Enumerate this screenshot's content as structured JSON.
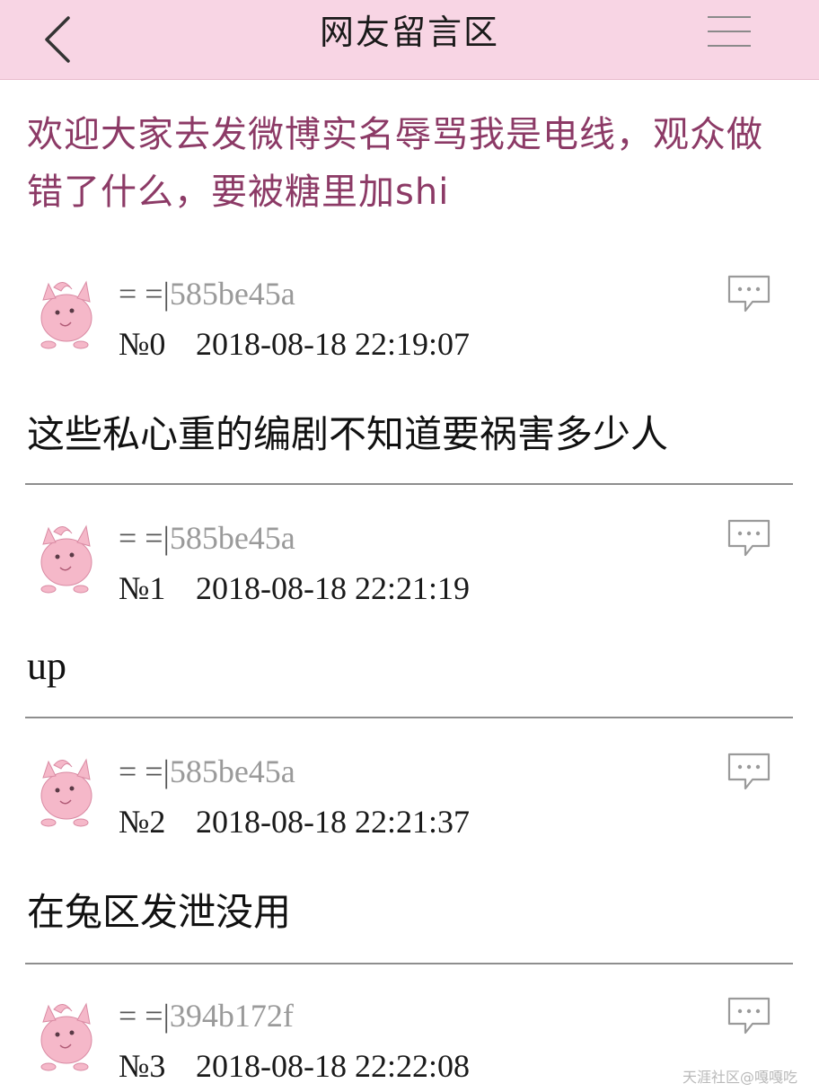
{
  "header": {
    "title": "网友留言区",
    "back_icon": "chevron-left-icon",
    "menu_icon": "hamburger-menu-icon"
  },
  "topic": {
    "title": "欢迎大家去发微博实名辱骂我是电线，观众做错了什么，要被糖里加shi"
  },
  "posts": [
    {
      "user_prefix": "= =|",
      "user_id": "585be45a",
      "floor": "№0",
      "time": "2018-08-18 22:19:07",
      "content": "这些私心重的编剧不知道要祸害多少人"
    },
    {
      "user_prefix": "= =|",
      "user_id": "585be45a",
      "floor": "№1",
      "time": "2018-08-18 22:21:19",
      "content": "up"
    },
    {
      "user_prefix": "= =|",
      "user_id": "585be45a",
      "floor": "№2",
      "time": "2018-08-18 22:21:37",
      "content": "在兔区发泄没用"
    },
    {
      "user_prefix": "= =|",
      "user_id": "394b172f",
      "floor": "№3",
      "time": "2018-08-18 22:22:08",
      "content": ""
    }
  ],
  "watermark": "天涯社区@嘎嘎吃",
  "colors": {
    "header_bg": "#f8d5e4",
    "topic_text": "#8c3a66",
    "avatar_pink": "#f5b8c9"
  }
}
